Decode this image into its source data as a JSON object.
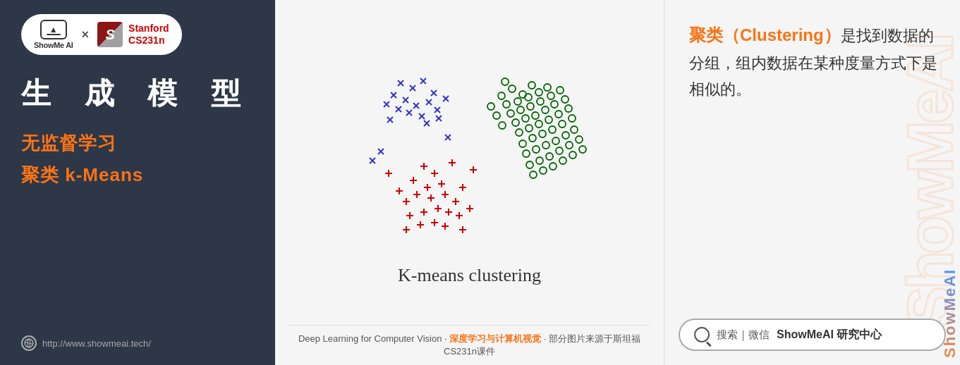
{
  "left": {
    "logo_showmeai": "ShowMe AI",
    "x_separator": "×",
    "stanford_name": "Stanford",
    "stanford_course": "CS231n",
    "main_title": "生 成 模 型",
    "subtitle1": "无监督学习",
    "subtitle2": "聚类 k-Means",
    "website": "http://www.showmeai.tech/"
  },
  "center": {
    "chart_title": "K-means clustering",
    "footer_text": "Deep Learning for Computer Vision · 深度学习与计算机视觉 · 部分图片来源于斯坦福CS231n课件"
  },
  "right": {
    "watermark": "ShowMeAI",
    "description_part1": "聚类（Clustering）",
    "description_part2": "是找到数据的分组，组内数据在某种度量方式下是相似的。",
    "search_label": "搜索｜微信",
    "search_brand": "ShowMeAI 研究中心"
  }
}
